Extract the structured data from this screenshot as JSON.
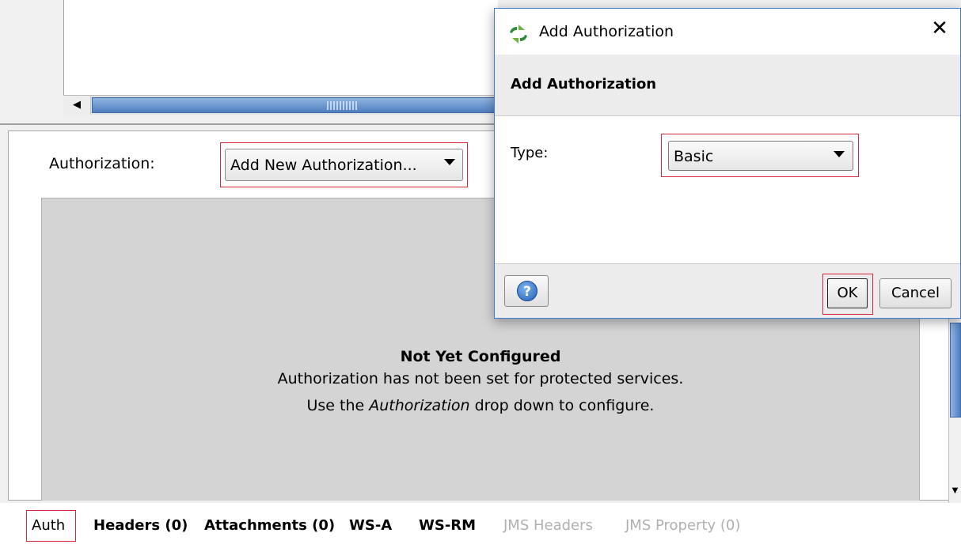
{
  "editor": {
    "scroll_left_glyph": "◀"
  },
  "authorization": {
    "label": "Authorization:",
    "dropdown_value": "Add New Authorization...",
    "empty_title": "Not Yet Configured",
    "empty_line1": "Authorization has not been set for protected services.",
    "empty_line2_prefix": "Use the ",
    "empty_line2_emphasis": "Authorization",
    "empty_line2_suffix": " drop down to configure."
  },
  "tabs": [
    {
      "label": "Auth",
      "enabled": true,
      "selected": true
    },
    {
      "label": "Headers (0)",
      "enabled": true
    },
    {
      "label": "Attachments (0)",
      "enabled": true
    },
    {
      "label": "WS-A",
      "enabled": true
    },
    {
      "label": "WS-RM",
      "enabled": true
    },
    {
      "label": "JMS Headers",
      "enabled": false
    },
    {
      "label": "JMS Property (0)",
      "enabled": false
    }
  ],
  "dialog": {
    "window_title": "Add Authorization",
    "close_glyph": "✕",
    "header_title": "Add Authorization",
    "type_label": "Type:",
    "type_value": "Basic",
    "help_glyph": "?",
    "ok_label": "OK",
    "cancel_label": "Cancel",
    "logo_icon": "soapui-logo-icon",
    "accent_color": "#3c7fd4"
  },
  "colors": {
    "highlight_outline": "#d6283a",
    "scroll_thumb": "#4f7fc0"
  }
}
